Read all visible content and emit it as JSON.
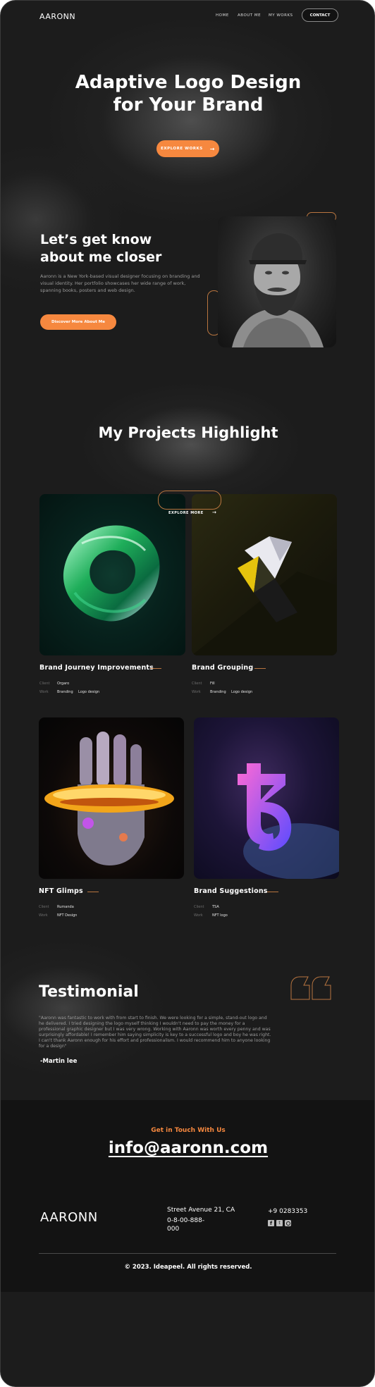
{
  "nav": {
    "logo": "AARONN",
    "links": [
      "HOME",
      "ABOUT ME",
      "MY WORKS"
    ],
    "contact_label": "CONTACT"
  },
  "hero": {
    "title_line1": "Adaptive Logo Design",
    "title_line2": "for Your Brand",
    "button_label": "EXPLORE WORKS",
    "button_arrow": "→"
  },
  "about": {
    "title_line1": "Let’s get know",
    "title_line2": "about me closer",
    "description": "Aaronn is a New York-based visual designer focusing on branding and visual identity. Her portfolio showcases her wide range of work, spanning books, posters and web design.",
    "button_label": "Discover More About Me"
  },
  "projects": {
    "title": "My Projects Highlight",
    "explore_label": "EXPLORE MORE",
    "explore_arrow": "→",
    "client_label": "Client",
    "work_label": "Work",
    "items": [
      {
        "title": "Brand Journey Improvements",
        "client": "Orgaro",
        "work": [
          "Branding",
          "Logo design"
        ]
      },
      {
        "title": "Brand Grouping",
        "client": "Fill",
        "work": [
          "Branding",
          "Logo design"
        ]
      },
      {
        "title": "NFT Glimps",
        "client": "Rumanda",
        "work": [
          "NFT Design"
        ]
      },
      {
        "title": "Brand Suggestions",
        "client": "TSA",
        "work": [
          "NFT logo"
        ]
      }
    ]
  },
  "testimonial": {
    "title": "Testimonial",
    "quote": "\"Aaronn was fantastic to work with from start to finish. We were looking for a simple, stand-out logo and he delivered. I tried designing the logo myself thinking I wouldn't need to pay the money for a professional graphic designer but I was very wrong. Working with Aaronn was worth every penny and was surprisingly affordable! I remember him saying simplicity is key to a successful logo and boy he was right. I can't thank Aaronn enough for his effort and professionalism. I would recommend him to anyone looking for a design\"",
    "author": "-Martin lee"
  },
  "contact": {
    "kicker": "Get in Touch With Us",
    "email": "info@aaronn.com"
  },
  "footer": {
    "logo": "AARONN",
    "address": "Street Avenue 21, CA",
    "phone_local": "0-8-00-888-000",
    "phone_intl": "+9 0283353",
    "social_icons": [
      "facebook-icon",
      "twitter-icon",
      "instagram-icon"
    ],
    "copyright": "© 2023. Ideapeel. All rights reserved."
  },
  "colors": {
    "accent": "#f6883f",
    "background": "#1c1c1c",
    "footer_background": "#131313"
  }
}
